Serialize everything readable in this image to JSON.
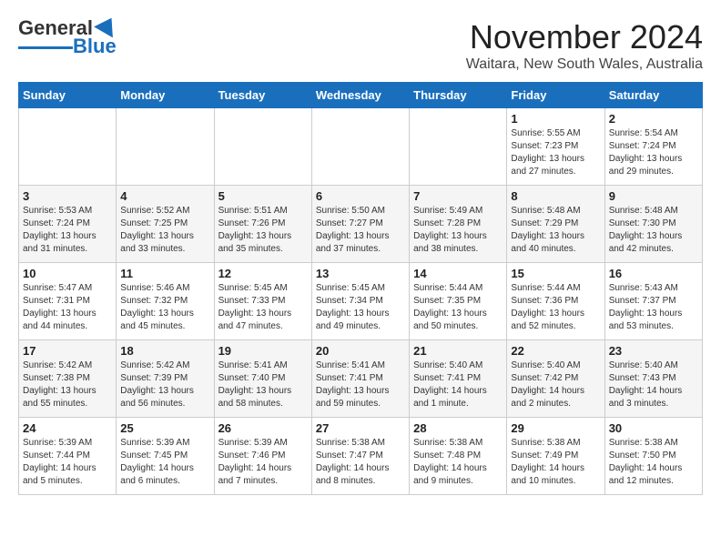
{
  "header": {
    "logo_main": "General",
    "logo_blue": "Blue",
    "month": "November 2024",
    "location": "Waitara, New South Wales, Australia"
  },
  "weekdays": [
    "Sunday",
    "Monday",
    "Tuesday",
    "Wednesday",
    "Thursday",
    "Friday",
    "Saturday"
  ],
  "weeks": [
    [
      {
        "day": "",
        "sunrise": "",
        "sunset": "",
        "daylight": ""
      },
      {
        "day": "",
        "sunrise": "",
        "sunset": "",
        "daylight": ""
      },
      {
        "day": "",
        "sunrise": "",
        "sunset": "",
        "daylight": ""
      },
      {
        "day": "",
        "sunrise": "",
        "sunset": "",
        "daylight": ""
      },
      {
        "day": "",
        "sunrise": "",
        "sunset": "",
        "daylight": ""
      },
      {
        "day": "1",
        "sunrise": "Sunrise: 5:55 AM",
        "sunset": "Sunset: 7:23 PM",
        "daylight": "Daylight: 13 hours and 27 minutes."
      },
      {
        "day": "2",
        "sunrise": "Sunrise: 5:54 AM",
        "sunset": "Sunset: 7:24 PM",
        "daylight": "Daylight: 13 hours and 29 minutes."
      }
    ],
    [
      {
        "day": "3",
        "sunrise": "Sunrise: 5:53 AM",
        "sunset": "Sunset: 7:24 PM",
        "daylight": "Daylight: 13 hours and 31 minutes."
      },
      {
        "day": "4",
        "sunrise": "Sunrise: 5:52 AM",
        "sunset": "Sunset: 7:25 PM",
        "daylight": "Daylight: 13 hours and 33 minutes."
      },
      {
        "day": "5",
        "sunrise": "Sunrise: 5:51 AM",
        "sunset": "Sunset: 7:26 PM",
        "daylight": "Daylight: 13 hours and 35 minutes."
      },
      {
        "day": "6",
        "sunrise": "Sunrise: 5:50 AM",
        "sunset": "Sunset: 7:27 PM",
        "daylight": "Daylight: 13 hours and 37 minutes."
      },
      {
        "day": "7",
        "sunrise": "Sunrise: 5:49 AM",
        "sunset": "Sunset: 7:28 PM",
        "daylight": "Daylight: 13 hours and 38 minutes."
      },
      {
        "day": "8",
        "sunrise": "Sunrise: 5:48 AM",
        "sunset": "Sunset: 7:29 PM",
        "daylight": "Daylight: 13 hours and 40 minutes."
      },
      {
        "day": "9",
        "sunrise": "Sunrise: 5:48 AM",
        "sunset": "Sunset: 7:30 PM",
        "daylight": "Daylight: 13 hours and 42 minutes."
      }
    ],
    [
      {
        "day": "10",
        "sunrise": "Sunrise: 5:47 AM",
        "sunset": "Sunset: 7:31 PM",
        "daylight": "Daylight: 13 hours and 44 minutes."
      },
      {
        "day": "11",
        "sunrise": "Sunrise: 5:46 AM",
        "sunset": "Sunset: 7:32 PM",
        "daylight": "Daylight: 13 hours and 45 minutes."
      },
      {
        "day": "12",
        "sunrise": "Sunrise: 5:45 AM",
        "sunset": "Sunset: 7:33 PM",
        "daylight": "Daylight: 13 hours and 47 minutes."
      },
      {
        "day": "13",
        "sunrise": "Sunrise: 5:45 AM",
        "sunset": "Sunset: 7:34 PM",
        "daylight": "Daylight: 13 hours and 49 minutes."
      },
      {
        "day": "14",
        "sunrise": "Sunrise: 5:44 AM",
        "sunset": "Sunset: 7:35 PM",
        "daylight": "Daylight: 13 hours and 50 minutes."
      },
      {
        "day": "15",
        "sunrise": "Sunrise: 5:44 AM",
        "sunset": "Sunset: 7:36 PM",
        "daylight": "Daylight: 13 hours and 52 minutes."
      },
      {
        "day": "16",
        "sunrise": "Sunrise: 5:43 AM",
        "sunset": "Sunset: 7:37 PM",
        "daylight": "Daylight: 13 hours and 53 minutes."
      }
    ],
    [
      {
        "day": "17",
        "sunrise": "Sunrise: 5:42 AM",
        "sunset": "Sunset: 7:38 PM",
        "daylight": "Daylight: 13 hours and 55 minutes."
      },
      {
        "day": "18",
        "sunrise": "Sunrise: 5:42 AM",
        "sunset": "Sunset: 7:39 PM",
        "daylight": "Daylight: 13 hours and 56 minutes."
      },
      {
        "day": "19",
        "sunrise": "Sunrise: 5:41 AM",
        "sunset": "Sunset: 7:40 PM",
        "daylight": "Daylight: 13 hours and 58 minutes."
      },
      {
        "day": "20",
        "sunrise": "Sunrise: 5:41 AM",
        "sunset": "Sunset: 7:41 PM",
        "daylight": "Daylight: 13 hours and 59 minutes."
      },
      {
        "day": "21",
        "sunrise": "Sunrise: 5:40 AM",
        "sunset": "Sunset: 7:41 PM",
        "daylight": "Daylight: 14 hours and 1 minute."
      },
      {
        "day": "22",
        "sunrise": "Sunrise: 5:40 AM",
        "sunset": "Sunset: 7:42 PM",
        "daylight": "Daylight: 14 hours and 2 minutes."
      },
      {
        "day": "23",
        "sunrise": "Sunrise: 5:40 AM",
        "sunset": "Sunset: 7:43 PM",
        "daylight": "Daylight: 14 hours and 3 minutes."
      }
    ],
    [
      {
        "day": "24",
        "sunrise": "Sunrise: 5:39 AM",
        "sunset": "Sunset: 7:44 PM",
        "daylight": "Daylight: 14 hours and 5 minutes."
      },
      {
        "day": "25",
        "sunrise": "Sunrise: 5:39 AM",
        "sunset": "Sunset: 7:45 PM",
        "daylight": "Daylight: 14 hours and 6 minutes."
      },
      {
        "day": "26",
        "sunrise": "Sunrise: 5:39 AM",
        "sunset": "Sunset: 7:46 PM",
        "daylight": "Daylight: 14 hours and 7 minutes."
      },
      {
        "day": "27",
        "sunrise": "Sunrise: 5:38 AM",
        "sunset": "Sunset: 7:47 PM",
        "daylight": "Daylight: 14 hours and 8 minutes."
      },
      {
        "day": "28",
        "sunrise": "Sunrise: 5:38 AM",
        "sunset": "Sunset: 7:48 PM",
        "daylight": "Daylight: 14 hours and 9 minutes."
      },
      {
        "day": "29",
        "sunrise": "Sunrise: 5:38 AM",
        "sunset": "Sunset: 7:49 PM",
        "daylight": "Daylight: 14 hours and 10 minutes."
      },
      {
        "day": "30",
        "sunrise": "Sunrise: 5:38 AM",
        "sunset": "Sunset: 7:50 PM",
        "daylight": "Daylight: 14 hours and 12 minutes."
      }
    ]
  ]
}
